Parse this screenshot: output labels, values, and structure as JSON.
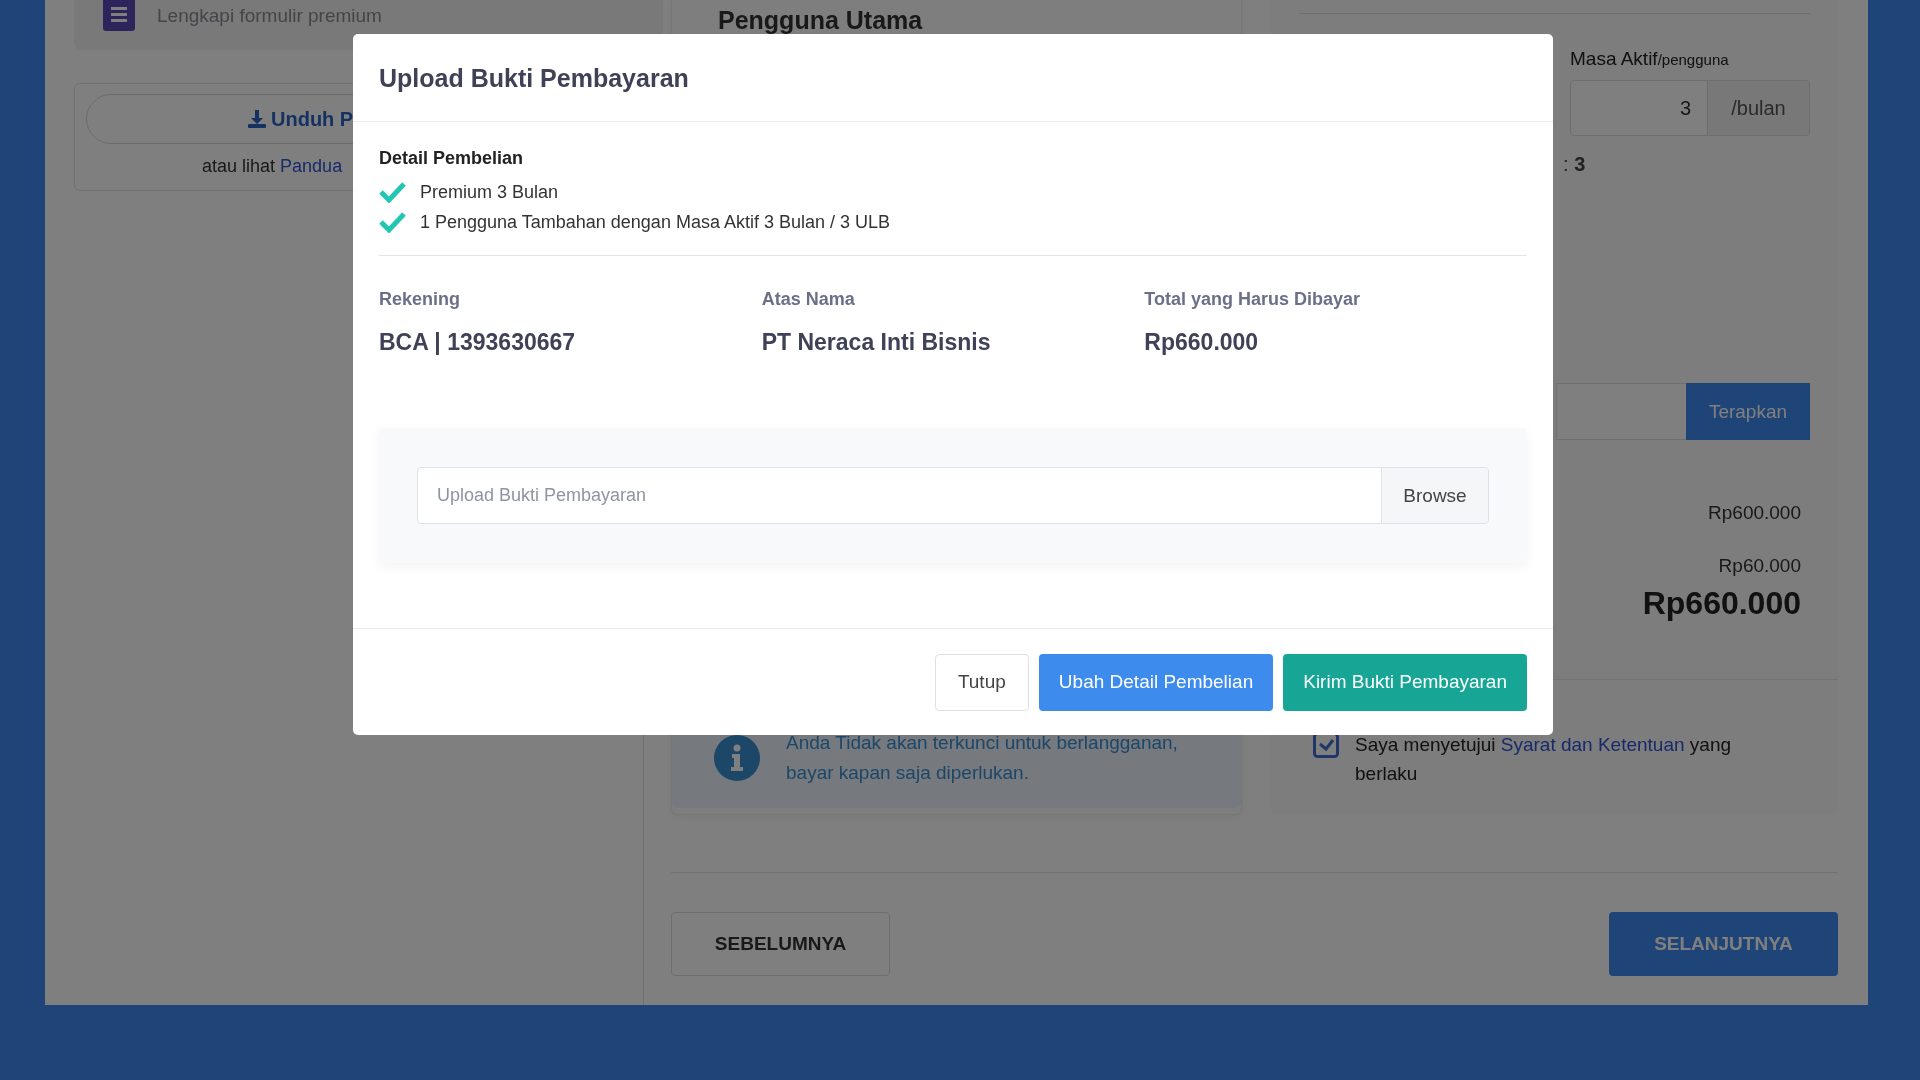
{
  "page": {
    "left": {
      "step_text": "Lengkapi formulir premium",
      "download_button": "Unduh P",
      "guide": {
        "prefix": "atau lihat",
        "link": "Pandua"
      }
    },
    "middle": {
      "heading": "Pengguna Utama",
      "info": "Anda Tidak akan terkunci untuk berlangganan, bayar kapan saja diperlukan."
    },
    "right": {
      "active_period_label": "Masa Aktif",
      "active_period_unit": "/pengguna",
      "active_period_value": "3",
      "active_period_addon": "/bulan",
      "users_count": ": **3**",
      "apply_button": "Terapkan",
      "amounts": [
        "Rp600.000",
        "Rp60.000"
      ],
      "total": "Rp660.000",
      "agreement": {
        "checked": true,
        "prefix": "Saya menyetujui",
        "link": "Syarat dan Ketentuan",
        "suffix": "yang berlaku"
      }
    },
    "nav": {
      "previous": "SEBELUMNYA",
      "next": "SELANJUTNYA"
    }
  },
  "modal": {
    "title": "Upload Bukti Pembayaran",
    "details_heading": "Detail Pembelian",
    "items": [
      "Premium 3 Bulan",
      "1 Pengguna Tambahan dengan Masa Aktif 3 Bulan / 3 ULB"
    ],
    "info": [
      {
        "label": "Rekening",
        "value": "BCA | 1393630667"
      },
      {
        "label": "Atas Nama",
        "value": "PT Neraca Inti Bisnis"
      },
      {
        "label": "Total yang Harus Dibayar",
        "value": "Rp660.000"
      }
    ],
    "upload": {
      "placeholder": "Upload Bukti Pembayaran",
      "browse": "Browse"
    },
    "buttons": [
      {
        "kind": "plain",
        "label": "Tutup"
      },
      {
        "kind": "primary",
        "label": "Ubah Detail Pembelian"
      },
      {
        "kind": "success",
        "label": "Kirim Bukti Pembayaran"
      }
    ]
  }
}
